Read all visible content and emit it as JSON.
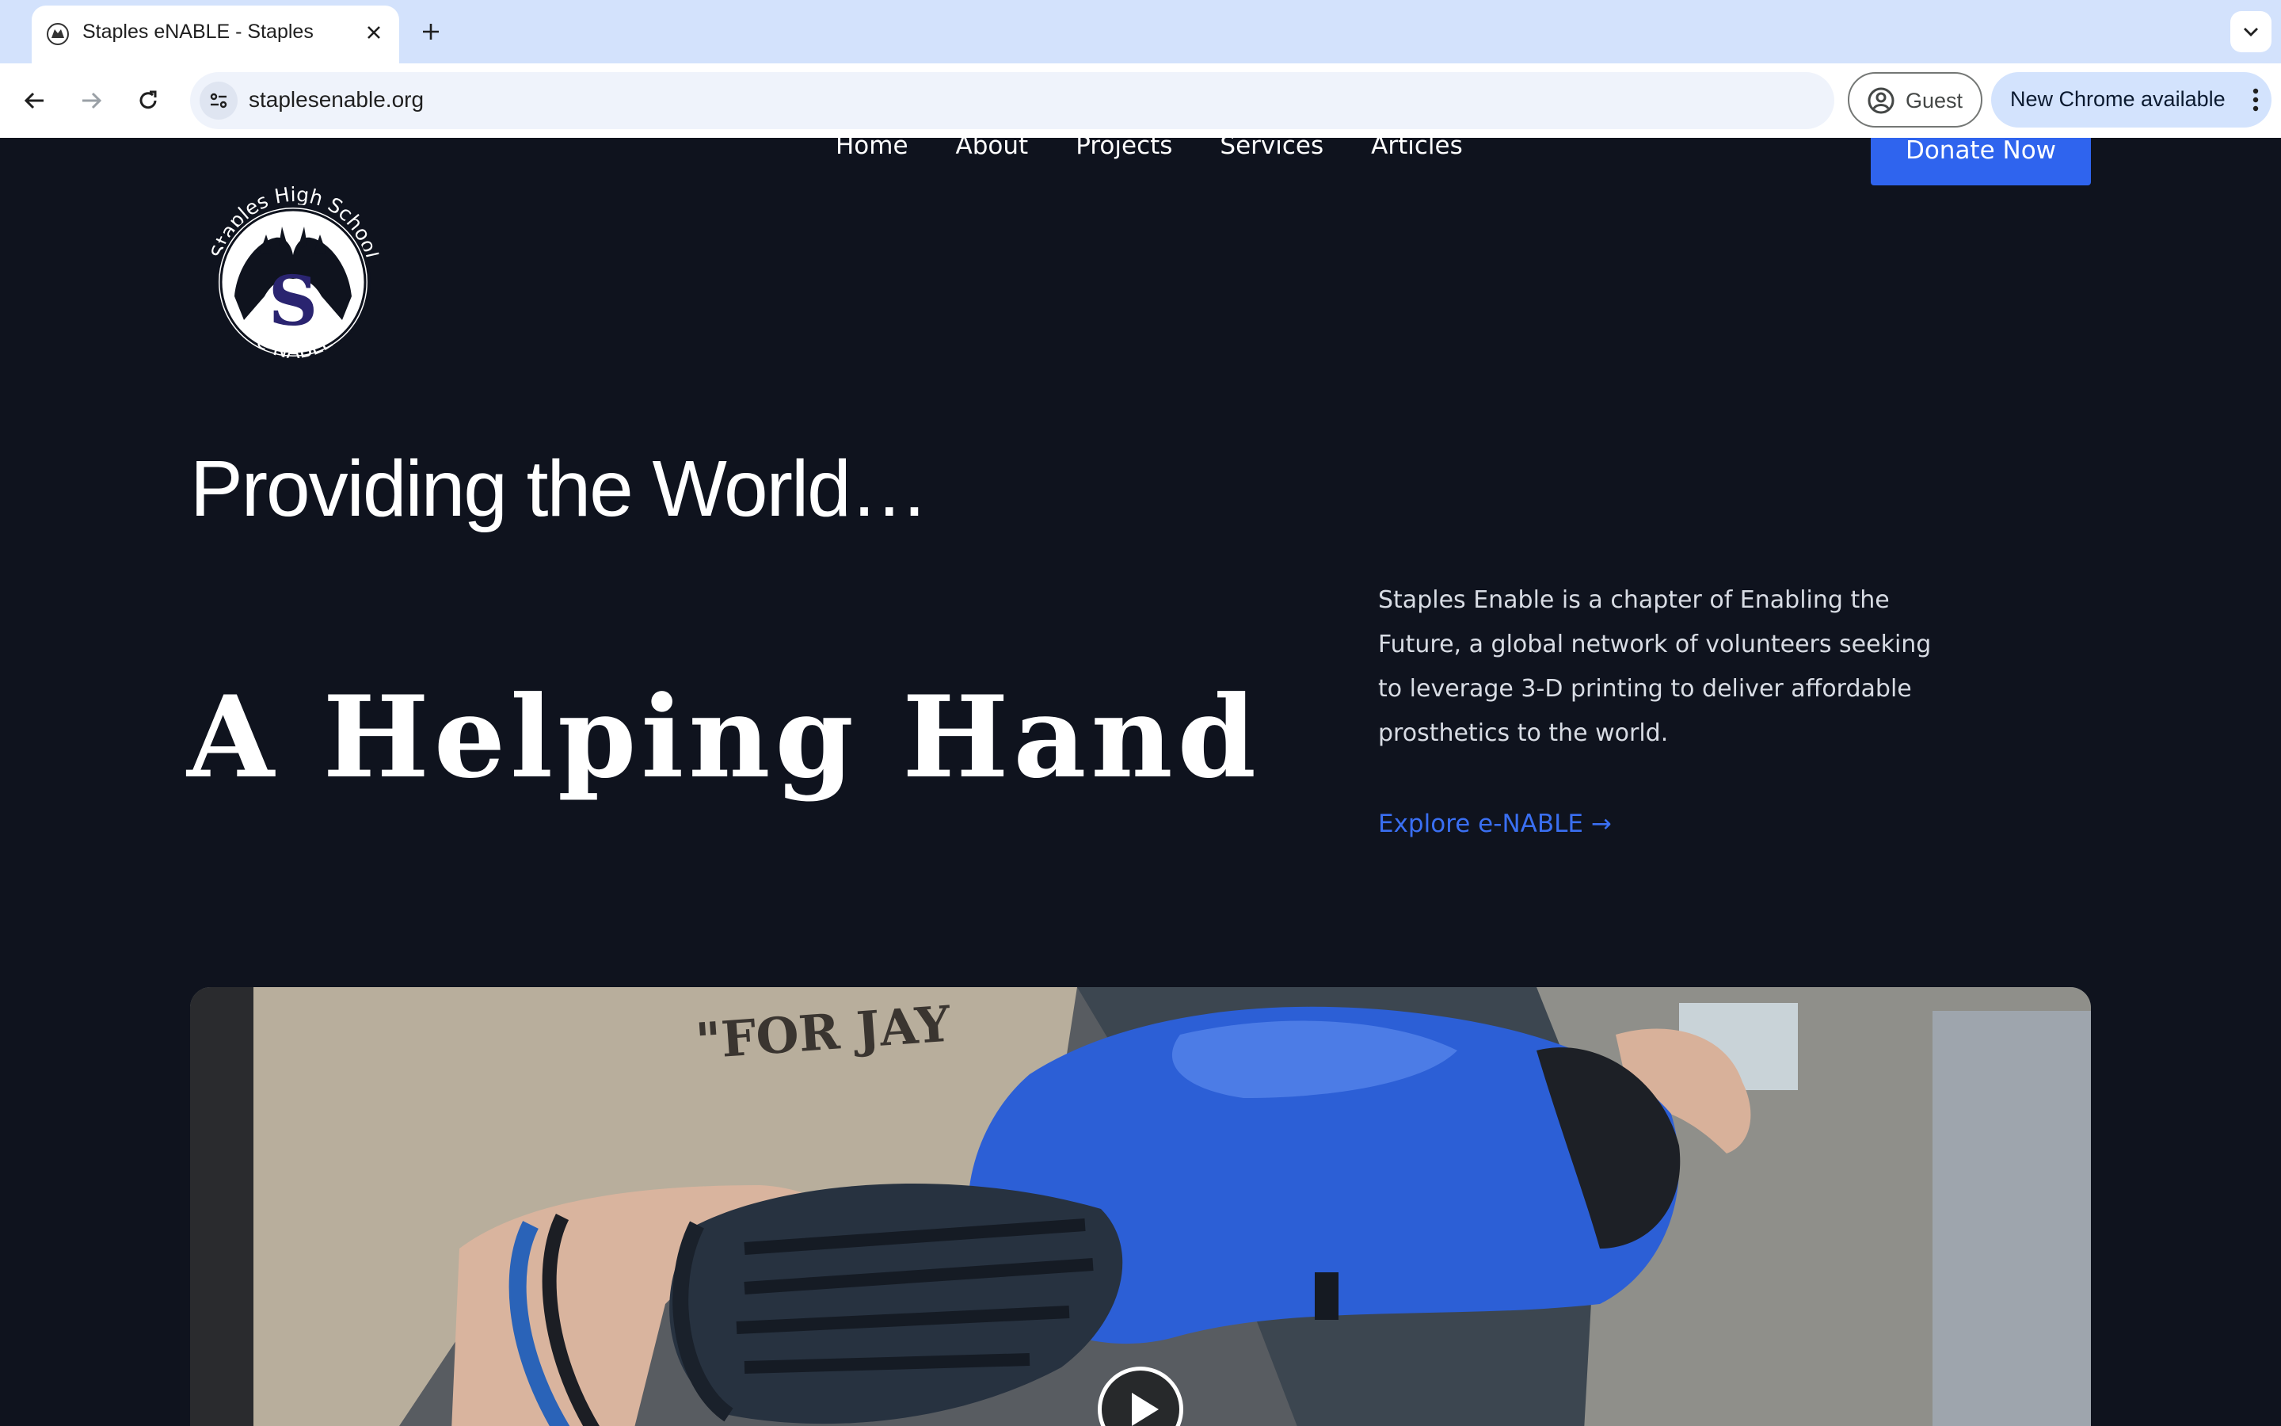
{
  "browser": {
    "tab": {
      "title": "Staples eNABLE - Staples"
    },
    "address_bar": {
      "url": "staplesenable.org"
    },
    "profile": {
      "label": "Guest"
    },
    "update_chip": {
      "label": "New Chrome available"
    }
  },
  "site": {
    "logo": {
      "alt": "Staples High School e-NABLE",
      "top_text": "Staples High School",
      "bottom_text": "e-NABLE"
    },
    "nav": {
      "items": [
        {
          "label": "Home"
        },
        {
          "label": "About"
        },
        {
          "label": "Projects"
        },
        {
          "label": "Services"
        },
        {
          "label": "Articles"
        }
      ]
    },
    "donate": {
      "label": "Donate Now"
    },
    "hero": {
      "subtitle": "Providing the World…",
      "title": "A Helping Hand",
      "description": "Staples Enable is a chapter of Enabling the Future, a global network of volunteers seeking to leverage 3-D printing to deliver affordable prosthetics to the world.",
      "cta": "Explore e-NABLE →"
    },
    "video": {
      "shirt_text": "\"FOR JAY"
    }
  },
  "colors": {
    "page_background": "#0f131e",
    "accent_blue": "#2f64ee",
    "link_blue": "#3a6ff2",
    "tabstrip": "#d3e2fc"
  }
}
